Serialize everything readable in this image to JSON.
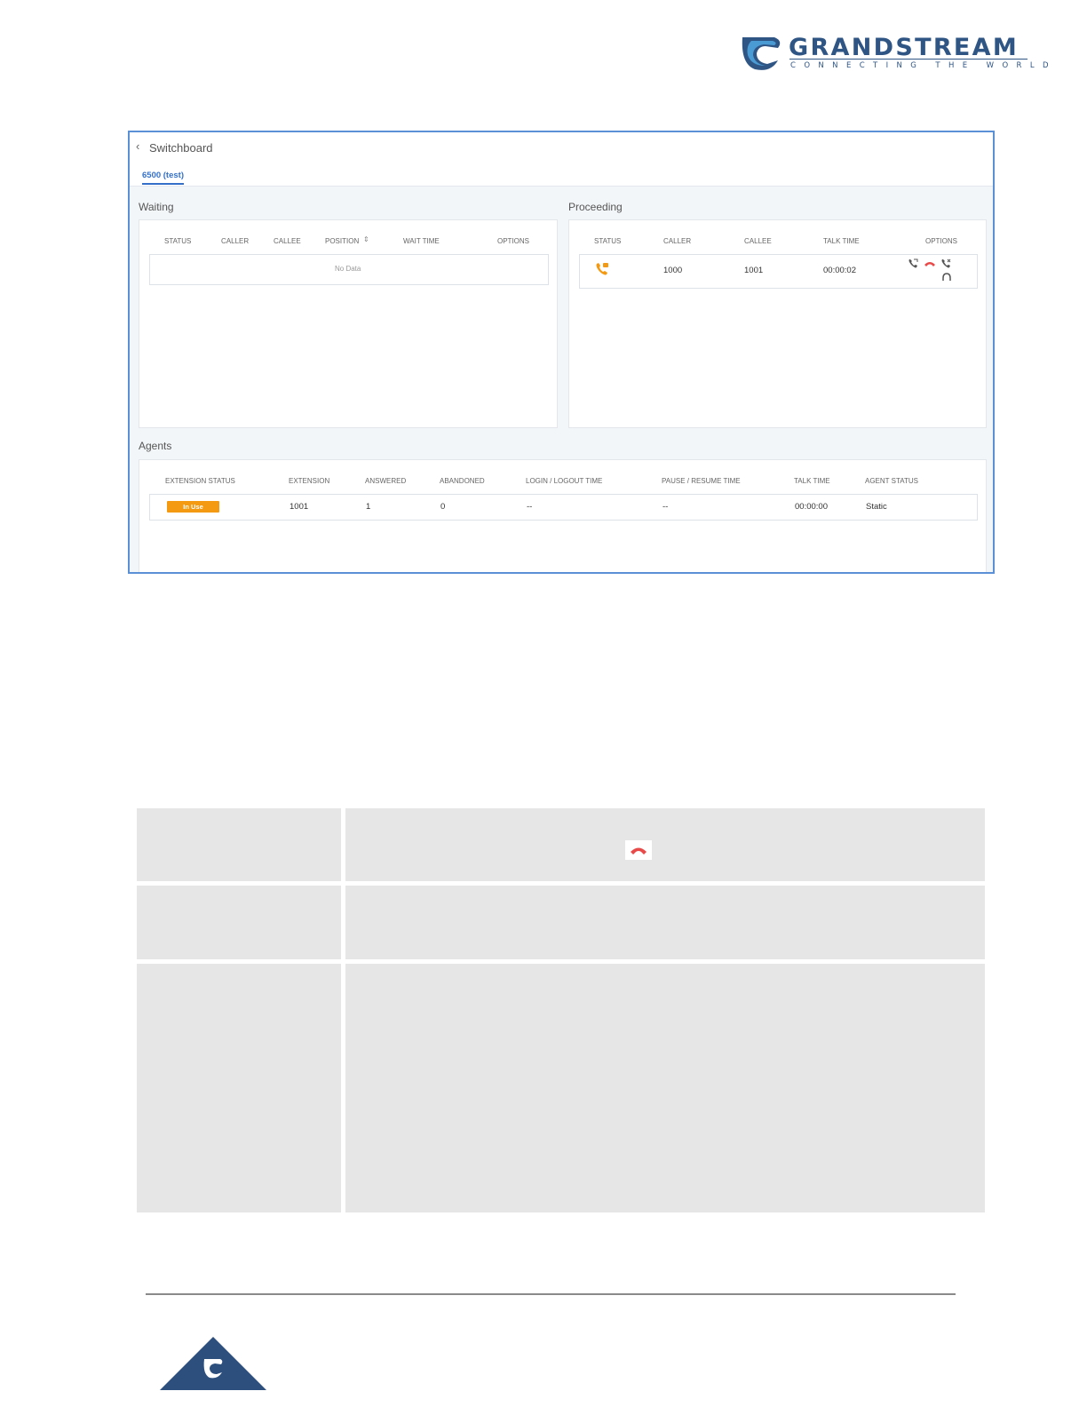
{
  "brand": {
    "name": "GRANDSTREAM",
    "tagline": "CONNECTING THE WORLD",
    "colors": {
      "primary": "#2f5585",
      "accent": "#3a7fc4"
    }
  },
  "switchboard": {
    "back_icon": "chevron-left-icon",
    "title": "Switchboard",
    "tab": "6500 (test)",
    "waiting": {
      "title": "Waiting",
      "headers": [
        "STATUS",
        "CALLER",
        "CALLEE",
        "POSITION",
        "WAIT TIME",
        "OPTIONS"
      ],
      "sort_icon": "sort-icon",
      "empty_text": "No Data"
    },
    "proceeding": {
      "title": "Proceeding",
      "headers": [
        "STATUS",
        "CALLER",
        "CALLEE",
        "TALK TIME",
        "OPTIONS"
      ],
      "row": {
        "status_icon": "phone-talking-icon",
        "caller": "1000",
        "callee": "1001",
        "talk_time": "00:00:02",
        "option_icons": [
          "transfer-call-icon",
          "hangup-icon",
          "call-forward-icon",
          "headset-monitor-icon"
        ]
      }
    },
    "agents": {
      "title": "Agents",
      "headers": [
        "EXTENSION STATUS",
        "EXTENSION",
        "ANSWERED",
        "ABANDONED",
        "LOGIN / LOGOUT TIME",
        "PAUSE / RESUME TIME",
        "TALK TIME",
        "AGENT STATUS"
      ],
      "row": {
        "status": "In Use",
        "extension": "1001",
        "answered": "1",
        "abandoned": "0",
        "login_logout": "--",
        "pause_resume": "--",
        "talk_time": "00:00:00",
        "agent_status": "Static"
      },
      "colors": {
        "in_use": "#f49a12"
      }
    }
  },
  "table": {
    "hangup_icon": "hangup-icon",
    "hangup_color": "#e84a4a"
  }
}
